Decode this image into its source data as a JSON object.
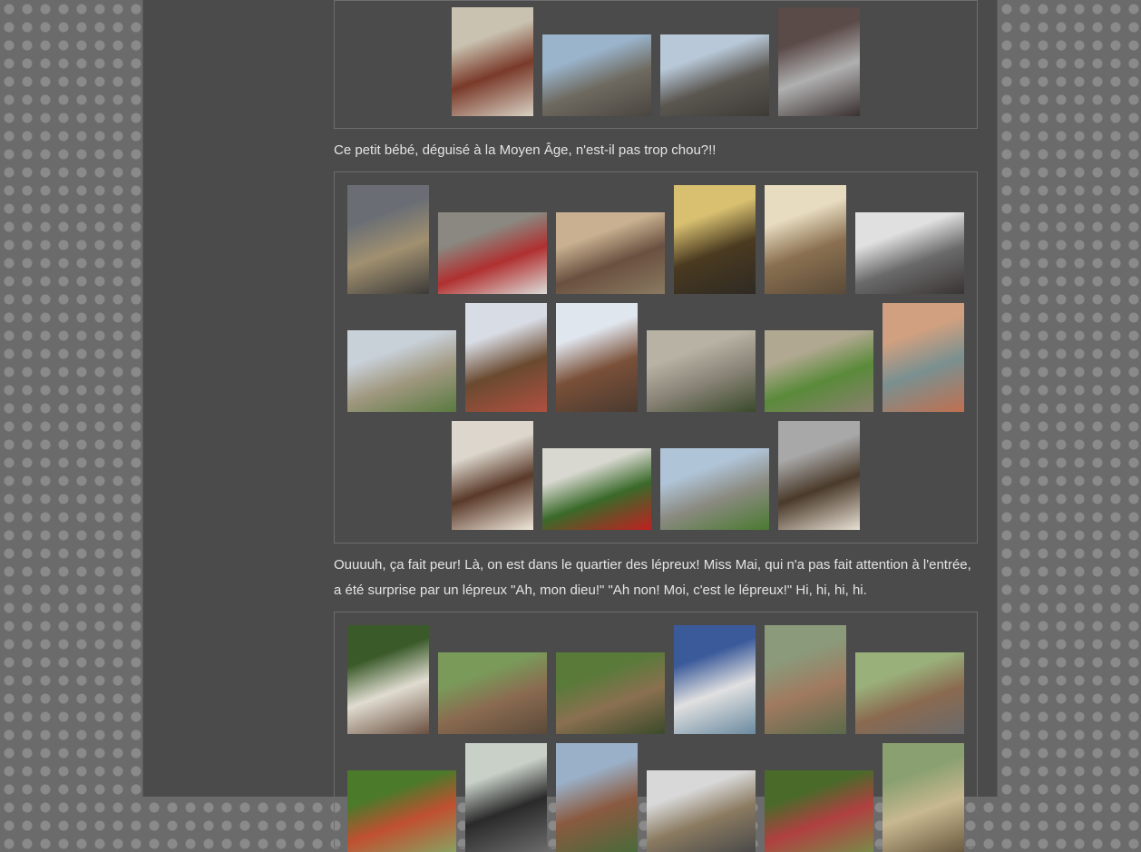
{
  "captions": {
    "baby": "Ce petit bébé, déguisé à la Moyen Âge, n'est-il pas trop chou?!!",
    "lepers": "Ouuuuh, ça fait peur! Là, on est dans le quartier des lépreux! Miss Mai, qui n'a pas fait attention à l'entrée, a été surprise par un lépreux \"Ah, mon dieu!\" \"Ah non! Moi, c'est le lépreux!\" Hi, hi, hi, hi."
  },
  "galleries": {
    "top": [
      {
        "name": "market-stall-photo",
        "colors": [
          "#c9c2b0",
          "#7a3a2a",
          "#d8d2c4"
        ]
      },
      {
        "name": "village-street-photo",
        "colors": [
          "#9ab4cc",
          "#6e6a60",
          "#4a4540"
        ]
      },
      {
        "name": "timbered-street-photo",
        "colors": [
          "#b8c8d8",
          "#5a5650",
          "#3e3a36"
        ]
      },
      {
        "name": "armor-gauntlets-photo",
        "colors": [
          "#5a4a48",
          "#b0b0b0",
          "#3a3030"
        ]
      }
    ],
    "baby": [
      {
        "name": "forge-stall-photo",
        "colors": [
          "#6a6e74",
          "#a09070",
          "#3c3a38"
        ]
      },
      {
        "name": "child-pots-photo",
        "colors": [
          "#8a8880",
          "#b03030",
          "#dcdcd8"
        ]
      },
      {
        "name": "wooden-utensils-photo",
        "colors": [
          "#c8b090",
          "#6a5040",
          "#8a7a60"
        ]
      },
      {
        "name": "tools-rack-photo",
        "colors": [
          "#d8c070",
          "#4a3a20",
          "#2e2a24"
        ]
      },
      {
        "name": "flatbread-stall-photo",
        "colors": [
          "#e8dcc0",
          "#8a7050",
          "#5a4a38"
        ]
      },
      {
        "name": "helmets-shelf-photo",
        "colors": [
          "#e0e0e0",
          "#6a6a6a",
          "#3a3434"
        ]
      },
      {
        "name": "village-house-photo",
        "colors": [
          "#c8d0d8",
          "#a09880",
          "#5a7a40"
        ]
      },
      {
        "name": "halftimber-house-photo",
        "colors": [
          "#d8dce4",
          "#6a4a30",
          "#b05040"
        ]
      },
      {
        "name": "crooked-house-photo",
        "colors": [
          "#e0e6ee",
          "#7a5038",
          "#4a3a30"
        ]
      },
      {
        "name": "stone-window-photo",
        "colors": [
          "#b8b2a4",
          "#8a8478",
          "#3a4a2a"
        ]
      },
      {
        "name": "ivy-wall-photo",
        "colors": [
          "#b0a890",
          "#5a8a3a",
          "#8a8070"
        ]
      },
      {
        "name": "blue-door-photo",
        "colors": [
          "#d0a080",
          "#7a9090",
          "#c07050"
        ]
      },
      {
        "name": "baby-costume-photo",
        "colors": [
          "#dcd6cc",
          "#5a3a2a",
          "#f0e8dc"
        ]
      },
      {
        "name": "rose-wall-photo",
        "colors": [
          "#d8d8d0",
          "#3a6a2a",
          "#c02020"
        ]
      },
      {
        "name": "stone-house-garden-photo",
        "colors": [
          "#b0c4d8",
          "#8a8a80",
          "#4a7a30"
        ]
      },
      {
        "name": "baby-standing-photo",
        "colors": [
          "#a8a8a8",
          "#4a3a2a",
          "#e8e0d4"
        ]
      }
    ],
    "lepers": [
      {
        "name": "parchment-sign-photo",
        "colors": [
          "#3a5a2a",
          "#e0dcd0",
          "#6a5040"
        ]
      },
      {
        "name": "leper-procession-photo",
        "colors": [
          "#7a9a5a",
          "#8a6a50",
          "#5a4a3a"
        ]
      },
      {
        "name": "garden-cauldron-photo",
        "colors": [
          "#5a7a3a",
          "#8a7050",
          "#3a4a2a"
        ]
      },
      {
        "name": "blue-tent-stall-photo",
        "colors": [
          "#3a5a9a",
          "#e0e0e0",
          "#6a8aa0"
        ]
      },
      {
        "name": "costumed-lepers-photo",
        "colors": [
          "#8a9a7a",
          "#a07a60",
          "#5a6a4a"
        ]
      },
      {
        "name": "crowd-lepers-photo",
        "colors": [
          "#9ab07a",
          "#8a6a50",
          "#6a6a6a"
        ]
      },
      {
        "name": "flower-bed-photo",
        "colors": [
          "#4a7a2a",
          "#c05030",
          "#8aa060"
        ]
      },
      {
        "name": "knight-crowd-photo",
        "colors": [
          "#c8d0c8",
          "#2a2a2a",
          "#6a6a6a"
        ]
      },
      {
        "name": "hooded-figure-photo",
        "colors": [
          "#9ab0c8",
          "#8a5a40",
          "#4a6a3a"
        ]
      },
      {
        "name": "info-board-photo",
        "colors": [
          "#d8d8d8",
          "#8a7a60",
          "#4a4a4a"
        ]
      },
      {
        "name": "red-flowers-photo",
        "colors": [
          "#4a6a2a",
          "#b04040",
          "#7a8a4a"
        ]
      },
      {
        "name": "stone-ruins-photo",
        "colors": [
          "#8aa070",
          "#c8b890",
          "#6a5a40"
        ]
      }
    ]
  }
}
